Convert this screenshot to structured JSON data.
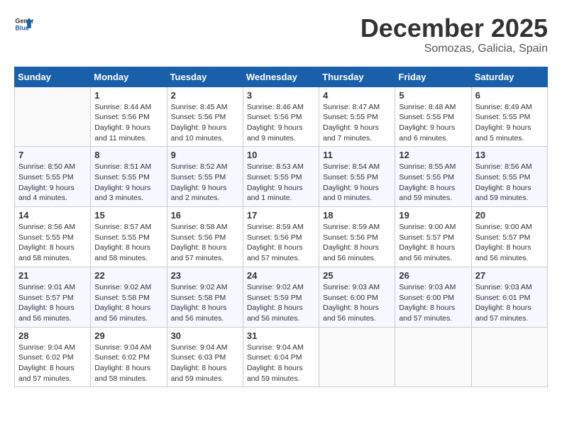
{
  "logo": {
    "line1": "General",
    "line2": "Blue"
  },
  "title": "December 2025",
  "location": "Somozas, Galicia, Spain",
  "days_of_week": [
    "Sunday",
    "Monday",
    "Tuesday",
    "Wednesday",
    "Thursday",
    "Friday",
    "Saturday"
  ],
  "weeks": [
    [
      {
        "day": "",
        "info": ""
      },
      {
        "day": "1",
        "info": "Sunrise: 8:44 AM\nSunset: 5:56 PM\nDaylight: 9 hours\nand 11 minutes."
      },
      {
        "day": "2",
        "info": "Sunrise: 8:45 AM\nSunset: 5:56 PM\nDaylight: 9 hours\nand 10 minutes."
      },
      {
        "day": "3",
        "info": "Sunrise: 8:46 AM\nSunset: 5:56 PM\nDaylight: 9 hours\nand 9 minutes."
      },
      {
        "day": "4",
        "info": "Sunrise: 8:47 AM\nSunset: 5:55 PM\nDaylight: 9 hours\nand 7 minutes."
      },
      {
        "day": "5",
        "info": "Sunrise: 8:48 AM\nSunset: 5:55 PM\nDaylight: 9 hours\nand 6 minutes."
      },
      {
        "day": "6",
        "info": "Sunrise: 8:49 AM\nSunset: 5:55 PM\nDaylight: 9 hours\nand 5 minutes."
      }
    ],
    [
      {
        "day": "7",
        "info": "Sunrise: 8:50 AM\nSunset: 5:55 PM\nDaylight: 9 hours\nand 4 minutes."
      },
      {
        "day": "8",
        "info": "Sunrise: 8:51 AM\nSunset: 5:55 PM\nDaylight: 9 hours\nand 3 minutes."
      },
      {
        "day": "9",
        "info": "Sunrise: 8:52 AM\nSunset: 5:55 PM\nDaylight: 9 hours\nand 2 minutes."
      },
      {
        "day": "10",
        "info": "Sunrise: 8:53 AM\nSunset: 5:55 PM\nDaylight: 9 hours\nand 1 minute."
      },
      {
        "day": "11",
        "info": "Sunrise: 8:54 AM\nSunset: 5:55 PM\nDaylight: 9 hours\nand 0 minutes."
      },
      {
        "day": "12",
        "info": "Sunrise: 8:55 AM\nSunset: 5:55 PM\nDaylight: 8 hours\nand 59 minutes."
      },
      {
        "day": "13",
        "info": "Sunrise: 8:56 AM\nSunset: 5:55 PM\nDaylight: 8 hours\nand 59 minutes."
      }
    ],
    [
      {
        "day": "14",
        "info": "Sunrise: 8:56 AM\nSunset: 5:55 PM\nDaylight: 8 hours\nand 58 minutes."
      },
      {
        "day": "15",
        "info": "Sunrise: 8:57 AM\nSunset: 5:55 PM\nDaylight: 8 hours\nand 58 minutes."
      },
      {
        "day": "16",
        "info": "Sunrise: 8:58 AM\nSunset: 5:56 PM\nDaylight: 8 hours\nand 57 minutes."
      },
      {
        "day": "17",
        "info": "Sunrise: 8:59 AM\nSunset: 5:56 PM\nDaylight: 8 hours\nand 57 minutes."
      },
      {
        "day": "18",
        "info": "Sunrise: 8:59 AM\nSunset: 5:56 PM\nDaylight: 8 hours\nand 56 minutes."
      },
      {
        "day": "19",
        "info": "Sunrise: 9:00 AM\nSunset: 5:57 PM\nDaylight: 8 hours\nand 56 minutes."
      },
      {
        "day": "20",
        "info": "Sunrise: 9:00 AM\nSunset: 5:57 PM\nDaylight: 8 hours\nand 56 minutes."
      }
    ],
    [
      {
        "day": "21",
        "info": "Sunrise: 9:01 AM\nSunset: 5:57 PM\nDaylight: 8 hours\nand 56 minutes."
      },
      {
        "day": "22",
        "info": "Sunrise: 9:02 AM\nSunset: 5:58 PM\nDaylight: 8 hours\nand 56 minutes."
      },
      {
        "day": "23",
        "info": "Sunrise: 9:02 AM\nSunset: 5:58 PM\nDaylight: 8 hours\nand 56 minutes."
      },
      {
        "day": "24",
        "info": "Sunrise: 9:02 AM\nSunset: 5:59 PM\nDaylight: 8 hours\nand 56 minutes."
      },
      {
        "day": "25",
        "info": "Sunrise: 9:03 AM\nSunset: 6:00 PM\nDaylight: 8 hours\nand 56 minutes."
      },
      {
        "day": "26",
        "info": "Sunrise: 9:03 AM\nSunset: 6:00 PM\nDaylight: 8 hours\nand 57 minutes."
      },
      {
        "day": "27",
        "info": "Sunrise: 9:03 AM\nSunset: 6:01 PM\nDaylight: 8 hours\nand 57 minutes."
      }
    ],
    [
      {
        "day": "28",
        "info": "Sunrise: 9:04 AM\nSunset: 6:02 PM\nDaylight: 8 hours\nand 57 minutes."
      },
      {
        "day": "29",
        "info": "Sunrise: 9:04 AM\nSunset: 6:02 PM\nDaylight: 8 hours\nand 58 minutes."
      },
      {
        "day": "30",
        "info": "Sunrise: 9:04 AM\nSunset: 6:03 PM\nDaylight: 8 hours\nand 59 minutes."
      },
      {
        "day": "31",
        "info": "Sunrise: 9:04 AM\nSunset: 6:04 PM\nDaylight: 8 hours\nand 59 minutes."
      },
      {
        "day": "",
        "info": ""
      },
      {
        "day": "",
        "info": ""
      },
      {
        "day": "",
        "info": ""
      }
    ]
  ]
}
